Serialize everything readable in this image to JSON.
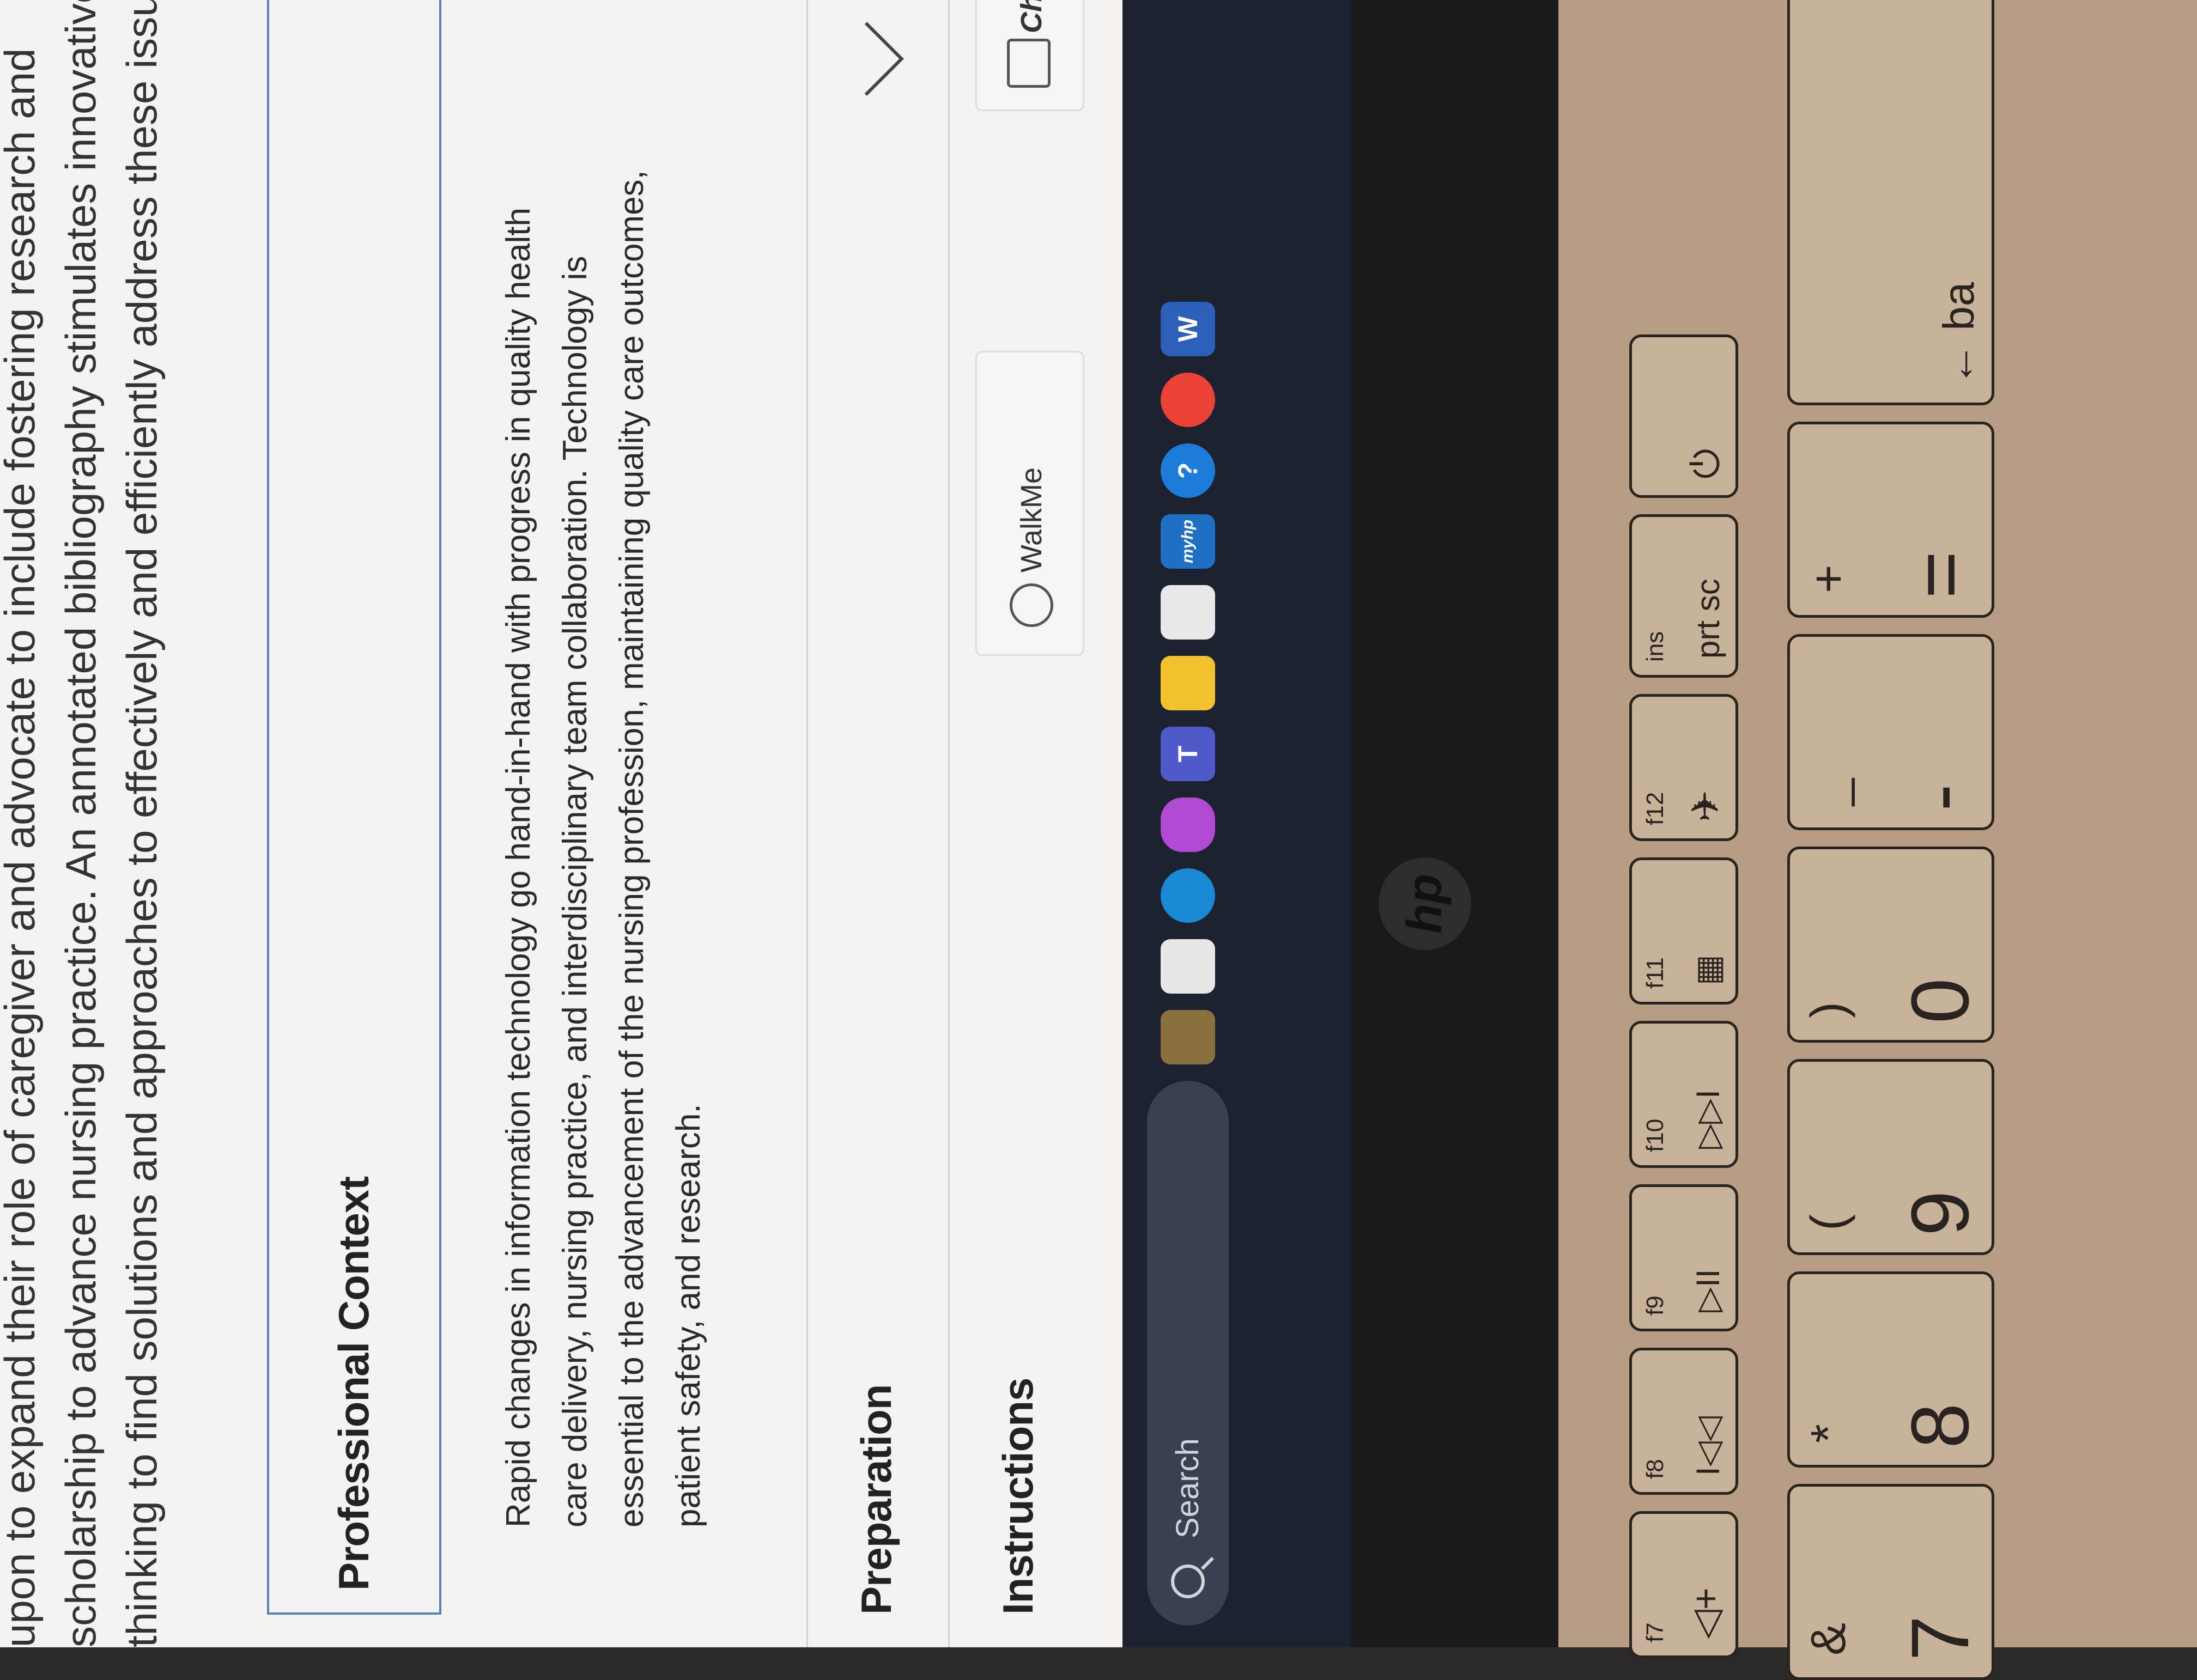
{
  "intro_lines": [
    "upon to expand their role of caregiver and advocate to include fostering research and",
    "scholarship to advance nursing practice. An annotated bibliography stimulates innovative",
    "thinking to find solutions and approaches to effectively and efficiently address these issues"
  ],
  "professional_context": {
    "title": "Professional Context",
    "body": [
      "Rapid changes in information technology go hand-in-hand with progress in quality health",
      "care delivery, nursing practice, and interdisciplinary team collaboration. Technology is",
      "essential to the advancement of the nursing profession, maintaining quality care outcomes,",
      "patient safety, and research."
    ]
  },
  "accordions": [
    {
      "title": "Preparation"
    },
    {
      "title": "Instructions"
    }
  ],
  "floating_buttons": {
    "walkme": "WalkMe",
    "chat": "Chat"
  },
  "taskbar": {
    "search_placeholder": "Search",
    "apps": [
      "edge-icon",
      "copilot-icon",
      "teams-icon",
      "file-explorer-icon",
      "store-icon",
      "myhp-icon",
      "help-icon",
      "chrome-icon",
      "word-icon"
    ],
    "myhp_label": "myhp",
    "word_label": "W"
  },
  "bezel": {
    "logo": "hp"
  },
  "keyboard": {
    "fn_keys": [
      {
        "id": "f7",
        "label": "f7",
        "icon": "◁+"
      },
      {
        "id": "f8",
        "label": "f8",
        "icon": "I◁◁"
      },
      {
        "id": "f9",
        "label": "f9",
        "icon": "▷II"
      },
      {
        "id": "f10",
        "label": "f10",
        "icon": "▷▷I"
      },
      {
        "id": "f11",
        "label": "f11",
        "icon": "keyboard-backlight-icon"
      },
      {
        "id": "f12",
        "label": "f12",
        "icon": "airplane-icon"
      },
      {
        "id": "prtsc",
        "label": "ins",
        "icon": "prt sc"
      }
    ],
    "num_keys": [
      {
        "id": "7",
        "top": "&",
        "main": "7"
      },
      {
        "id": "8",
        "top": "*",
        "main": "8"
      },
      {
        "id": "9",
        "top": "(",
        "main": "9"
      },
      {
        "id": "0",
        "top": ")",
        "main": "0"
      },
      {
        "id": "minus",
        "top": "_",
        "main": "-"
      },
      {
        "id": "equals",
        "top": "+",
        "main": "="
      }
    ],
    "backspace_label": "← ba"
  }
}
